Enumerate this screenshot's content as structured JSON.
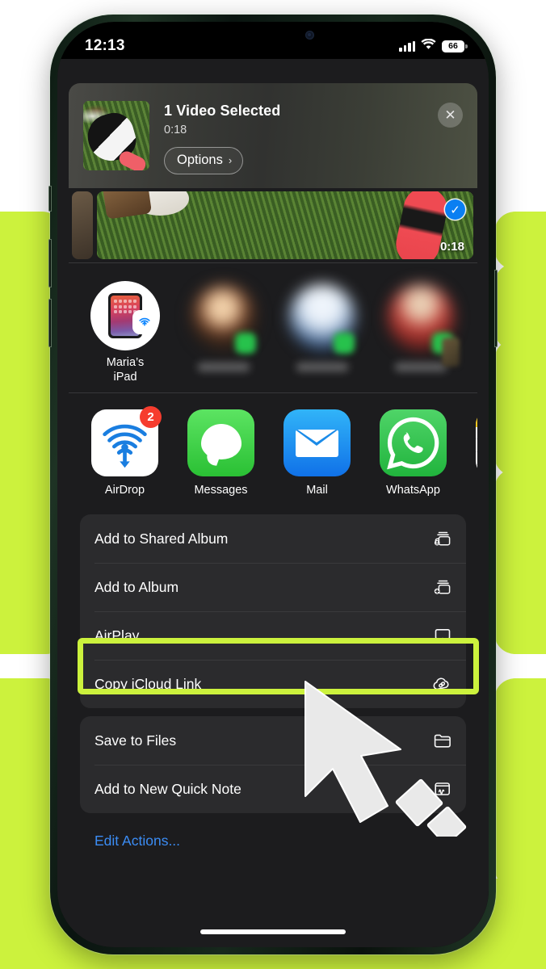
{
  "status_bar": {
    "time": "12:13",
    "battery_percent": "66",
    "signal_icon": "cellular-bars-icon",
    "wifi_icon": "wifi-icon",
    "battery_icon": "battery-icon"
  },
  "share_sheet": {
    "header": {
      "title": "1 Video Selected",
      "subtitle": "0:18",
      "options_label": "Options",
      "options_chevron": "›",
      "close_icon": "✕",
      "thumbnail_name": "video-thumbnail"
    },
    "photo_strip": {
      "duration": "0:18",
      "check_glyph": "✓",
      "selected": true
    },
    "airdrop_row": {
      "device_name_line1": "Maria’s",
      "device_name_line2": "iPad",
      "badge_icon": "airdrop-badge-icon",
      "blurred_contacts": 3
    },
    "apps": [
      {
        "label": "AirDrop",
        "icon": "airdrop-icon",
        "badge": "2"
      },
      {
        "label": "Messages",
        "icon": "messages-icon",
        "badge": ""
      },
      {
        "label": "Mail",
        "icon": "mail-icon",
        "badge": ""
      },
      {
        "label": "WhatsApp",
        "icon": "whatsapp-icon",
        "badge": ""
      },
      {
        "label": "",
        "icon": "notes-icon",
        "badge": ""
      }
    ],
    "action_groups": [
      {
        "rows": [
          {
            "label": "Add to Shared Album",
            "icon": "shared-album-icon"
          },
          {
            "label": "Add to Album",
            "icon": "add-to-album-icon"
          },
          {
            "label": "AirPlay",
            "icon": "airplay-icon",
            "highlighted": true
          },
          {
            "label": "Copy iCloud Link",
            "icon": "icloud-link-icon"
          }
        ]
      },
      {
        "rows": [
          {
            "label": "Save to Files",
            "icon": "folder-icon"
          },
          {
            "label": "Add to New Quick Note",
            "icon": "quick-note-icon"
          }
        ]
      }
    ],
    "edit_actions_label": "Edit Actions..."
  },
  "annotation": {
    "highlight_color": "#ccf23d",
    "highlight_target": "AirPlay",
    "cursor_icon": "arrow-cursor-icon"
  },
  "decoration": {
    "blob_color": "#ccf23d",
    "background_color": "#ffffff"
  },
  "home_indicator": "home-indicator"
}
